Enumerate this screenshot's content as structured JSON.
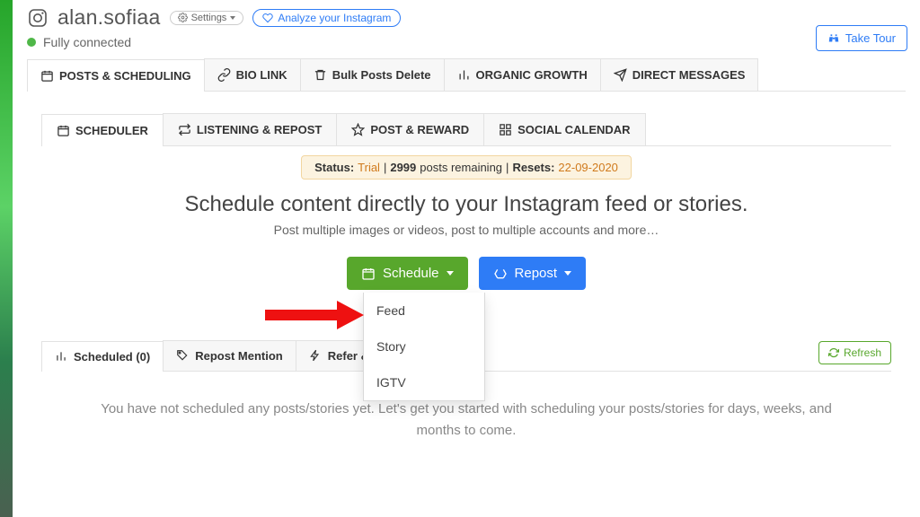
{
  "header": {
    "username": "alan.sofiaa",
    "settings_label": "Settings",
    "analyze_label": "Analyze your Instagram",
    "status_label": "Fully connected",
    "take_tour_label": "Take Tour"
  },
  "primary_tabs": [
    {
      "id": "posts-scheduling",
      "label": "POSTS & SCHEDULING",
      "icon": "calendar"
    },
    {
      "id": "bio-link",
      "label": "BIO LINK",
      "icon": "link"
    },
    {
      "id": "bulk-delete",
      "label": "Bulk Posts Delete",
      "icon": "trash"
    },
    {
      "id": "organic-growth",
      "label": "ORGANIC GROWTH",
      "icon": "bars"
    },
    {
      "id": "direct-messages",
      "label": "DIRECT MESSAGES",
      "icon": "send"
    }
  ],
  "secondary_tabs": [
    {
      "id": "scheduler",
      "label": "SCHEDULER",
      "icon": "calendar"
    },
    {
      "id": "listening-repost",
      "label": "LISTENING & REPOST",
      "icon": "repost"
    },
    {
      "id": "post-reward",
      "label": "POST & REWARD",
      "icon": "star"
    },
    {
      "id": "social-calendar",
      "label": "SOCIAL CALENDAR",
      "icon": "grid"
    }
  ],
  "status_banner": {
    "status_key": "Status:",
    "status_val": "Trial",
    "sep1": "|",
    "count": "2999",
    "count_suffix": "posts remaining",
    "sep2": "|",
    "resets_key": "Resets:",
    "resets_val": "22-09-2020"
  },
  "hero": {
    "title": "Schedule content directly to your Instagram feed or stories.",
    "subtitle": "Post multiple images or videos, post to multiple accounts and more…"
  },
  "cta": {
    "schedule_label": "Schedule",
    "repost_label": "Repost",
    "dropdown": [
      "Feed",
      "Story",
      "IGTV"
    ]
  },
  "third_tabs": {
    "scheduled": "Scheduled (0)",
    "repost_mention": "Repost Mention",
    "refer_earn": "Refer & Ea",
    "refresh": "Refresh"
  },
  "empty_state": "You have not scheduled any posts/stories yet. Let's get you started with scheduling your posts/stories for days, weeks, and months to come.",
  "colors": {
    "green": "#58a72c",
    "blue": "#2e7cf6",
    "orange": "#d07a1c"
  }
}
